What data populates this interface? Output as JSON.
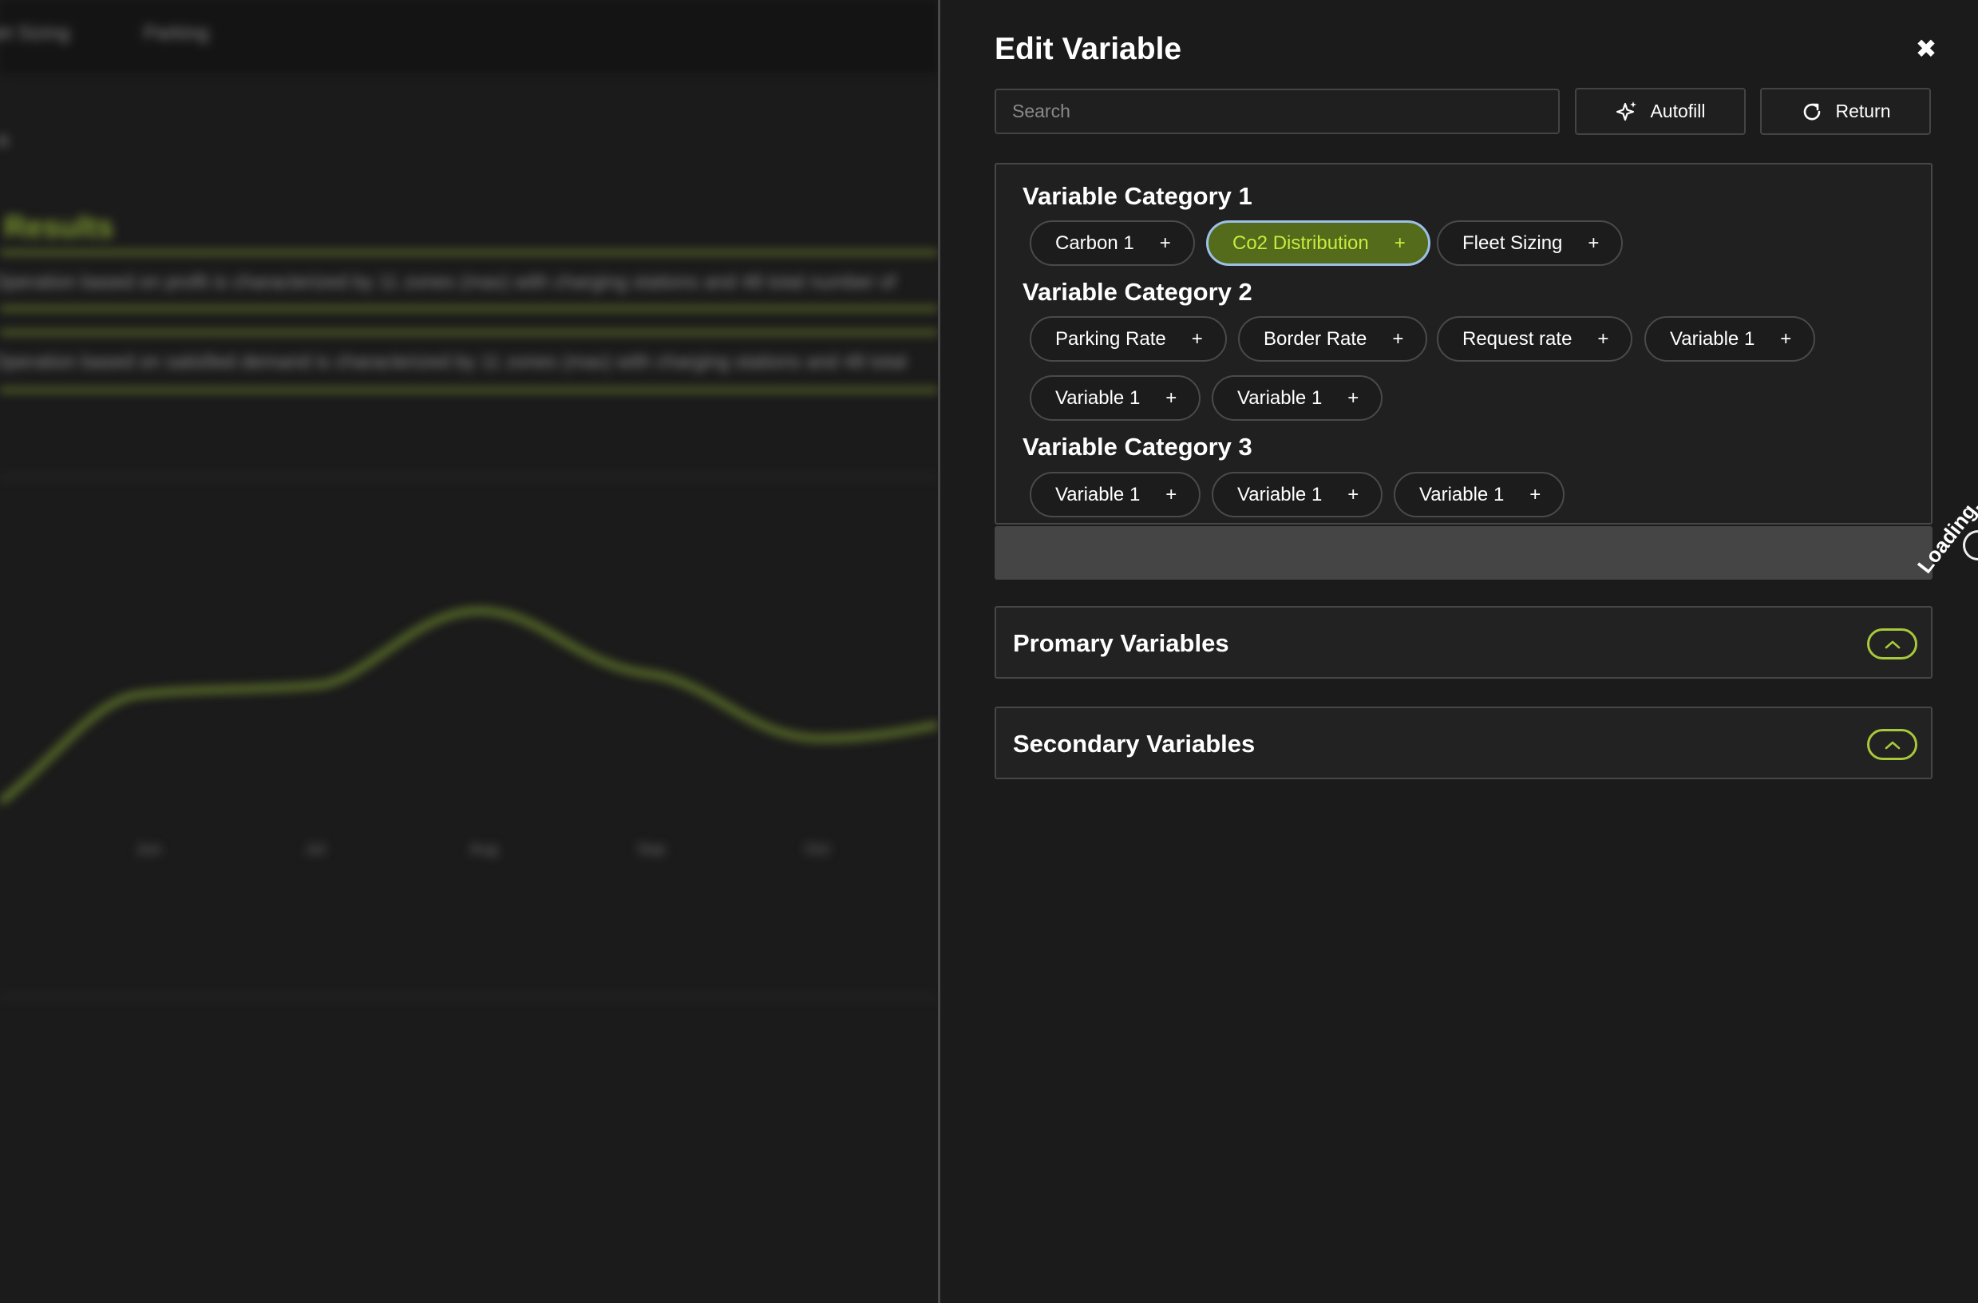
{
  "background": {
    "nav_items": [
      "Fleet Sizing",
      "Parking"
    ],
    "breadcrumb": "n",
    "section_title": "Results",
    "descriptions": [
      "Operation based on profit is characterized by 11 zones (max) with charging stations and 48 total number of",
      "Operation based on satisfied demand is characterized by 11 zones (max) with charging stations and 48 total"
    ],
    "months": [
      "Jun",
      "Jul",
      "Aug",
      "Sep",
      "Oct"
    ]
  },
  "panel": {
    "title": "Edit Variable",
    "close_icon": "✖",
    "search_placeholder": "Search",
    "autofill_label": "Autofill",
    "return_label": "Return",
    "categories": [
      {
        "title": "Variable Category 1",
        "chips": [
          {
            "label": "Carbon 1",
            "selected": false
          },
          {
            "label": "Co2 Distribution",
            "selected": true
          },
          {
            "label": "Fleet Sizing",
            "selected": false
          }
        ]
      },
      {
        "title": "Variable Category 2",
        "chips": [
          {
            "label": "Parking Rate",
            "selected": false
          },
          {
            "label": "Border Rate",
            "selected": false
          },
          {
            "label": "Request rate",
            "selected": false
          },
          {
            "label": "Variable 1",
            "selected": false
          },
          {
            "label": "Variable 1",
            "selected": false
          },
          {
            "label": "Variable 1",
            "selected": false
          }
        ]
      },
      {
        "title": "Variable Category 3",
        "chips": [
          {
            "label": "Variable 1",
            "selected": false
          },
          {
            "label": "Variable 1",
            "selected": false
          },
          {
            "label": "Variable 1",
            "selected": false
          }
        ]
      }
    ],
    "chip_plus": "+",
    "loading_text": "Loading...",
    "accordions": [
      {
        "label": "Promary Variables",
        "icon": "chevron-up-icon"
      },
      {
        "label": "Secondary Variables",
        "icon": "chevron-up-icon"
      }
    ]
  },
  "colors": {
    "accent": "#c9ec3e",
    "selected_chip_bg": "#536b1a",
    "selected_chip_border": "#9dc0e8",
    "background": "#1b1b1b"
  }
}
